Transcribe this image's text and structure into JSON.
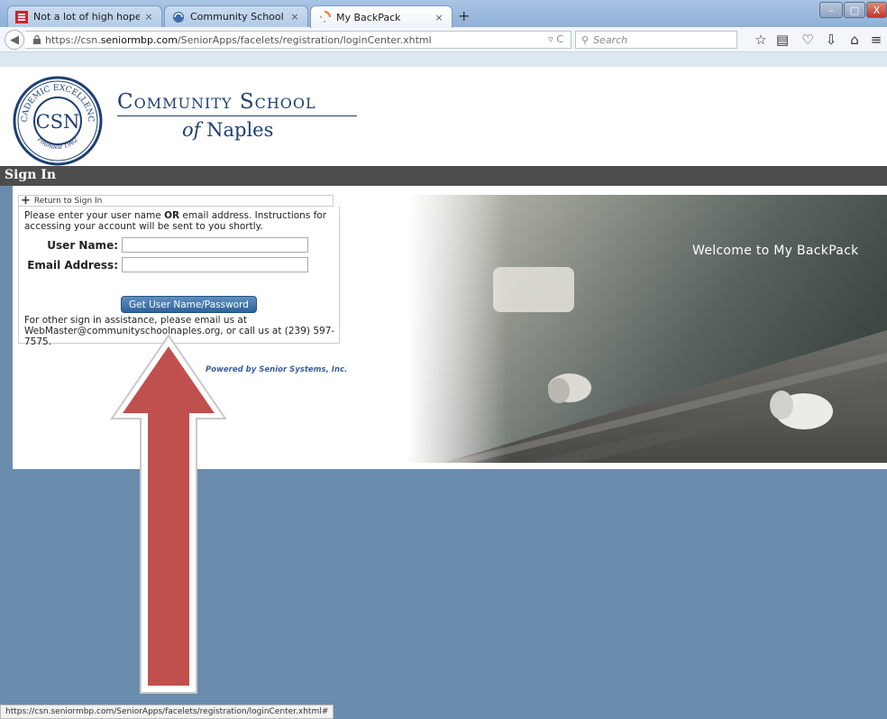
{
  "browser": {
    "tabs": [
      {
        "label": "Not a lot of high hopes for ...",
        "close": "×"
      },
      {
        "label": "Community School of Nap...",
        "close": "×"
      },
      {
        "label": "My BackPack",
        "close": "×"
      }
    ],
    "new_tab": "+",
    "url_prefix": "https://csn.",
    "url_host": "seniormbp.com",
    "url_path": "/SeniorApps/facelets/registration/loginCenter.xhtml",
    "url_tools": "▿ C",
    "search_placeholder": "Search",
    "window_controls": {
      "minimize": "–",
      "maximize": "□",
      "close": "X"
    },
    "status_url": "https://csn.seniormbp.com/SeniorApps/facelets/registration/loginCenter.xhtml#"
  },
  "school": {
    "name_line1": "Community School",
    "name_of": "of",
    "name_line2": "Naples",
    "seal_top": "ACADEMIC EXCELLENCE",
    "seal_monogram": "CSN",
    "seal_bottom": "Founded 1982"
  },
  "signin": {
    "bar_title": "Sign In",
    "return_link": "Return to Sign In",
    "instructions_before": "Please enter your user name ",
    "instructions_bold": "OR",
    "instructions_after": " email address. Instructions for accessing your account will be sent to you shortly.",
    "username_label": "User Name:",
    "username_value": "",
    "email_label": "Email Address:",
    "email_value": "",
    "submit_label": "Get User Name/Password",
    "assist_text": "For other sign in assistance, please email us at WebMaster@communityschoolnaples.org, or call us at (239) 597-7575.",
    "powered_by": "Powered by Senior Systems, Inc."
  },
  "hero": {
    "welcome": "Welcome to My BackPack"
  },
  "colors": {
    "page_bg": "#6a8cad",
    "brand_navy": "#1c3f73",
    "signin_bar": "#4d4d4d",
    "button": "#3a6fa4",
    "arrow": "#c0504d"
  }
}
